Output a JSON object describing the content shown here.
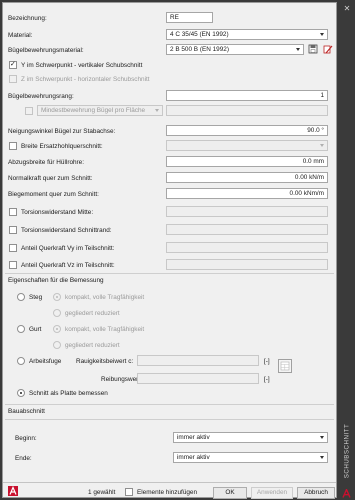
{
  "fields": {
    "bezeichnung_label": "Bezeichnung:",
    "bezeichnung_value": "RE",
    "material_label": "Material:",
    "material_value": "4 C 35/45 (EN 1992)",
    "buegel_mat_label": "Bügelbewehrungsmaterial:",
    "buegel_mat_value": "2 B 500 B (EN 1992)",
    "y_schwerpunkt_label": "Y im Schwerpunkt - vertikaler Schubschnitt",
    "z_schwerpunkt_label": "Z im Schwerpunkt - horizontaler Schubschnitt",
    "buegel_rang_label": "Bügelbewehrungsrang:",
    "buegel_rang_value": "1",
    "mindest_placeholder": "Mindestbewehrung Bügel pro Fläche",
    "neigung_label": "Neigungswinkel Bügel zur Stabachse:",
    "neigung_value": "90.0 °",
    "breite_ersatz_label": "Breite Ersatzhohlquerschnitt:",
    "abzug_label": "Abzugsbreite für Hüllrohre:",
    "abzug_value": "0.0 mm",
    "normalkraft_label": "Normalkraft quer zum Schnitt:",
    "normalkraft_value": "0.00 kN/m",
    "biegemoment_label": "Biegemoment quer zum Schnitt:",
    "biegemoment_value": "0.00 kNm/m",
    "torsion_mitte_label": "Torsionswiderstand Mitte:",
    "torsion_rand_label": "Torsionswiderstand Schnittrand:",
    "anteil_vy_label": "Anteil Querkraft Vy im Teilschnitt:",
    "anteil_vz_label": "Anteil Querkraft Vz im Teilschnitt:"
  },
  "bemessung": {
    "title": "Eigenschaften für die Bemessung",
    "steg_label": "Steg",
    "gurt_label": "Gurt",
    "kompakt_label": "kompakt, volle Tragfähigkeit",
    "gegliedert_label": "gegliedert reduziert",
    "arbeitsfuge_label": "Arbeitsfuge",
    "rauhigkeit_label": "Rauigkeitsbeiwert c:",
    "reibung_label": "Reibungswert µ:",
    "unit_dimless": "[-]",
    "platte_label": "Schnitt als Platte bemessen"
  },
  "bauabschnitt": {
    "title": "Bauabschnitt",
    "beginn_label": "Beginn:",
    "beginn_value": "immer aktiv",
    "ende_label": "Ende:",
    "ende_value": "immer aktiv"
  },
  "footer": {
    "selected_count": "1 gewählt",
    "elemente_label": "Elemente hinzufügen",
    "ok": "OK",
    "anwenden": "Anwenden",
    "abbruch": "Abbruch"
  },
  "side_tab": {
    "label": "SCHUBSCHNITT",
    "close_glyph": "✕"
  },
  "colors": {
    "side_bg": "#3a3a3a",
    "logo_red": "#c8102e"
  },
  "icons": [
    "material-library-icon",
    "material-edit-icon",
    "autodesk-logo-icon",
    "calculator-icon"
  ]
}
